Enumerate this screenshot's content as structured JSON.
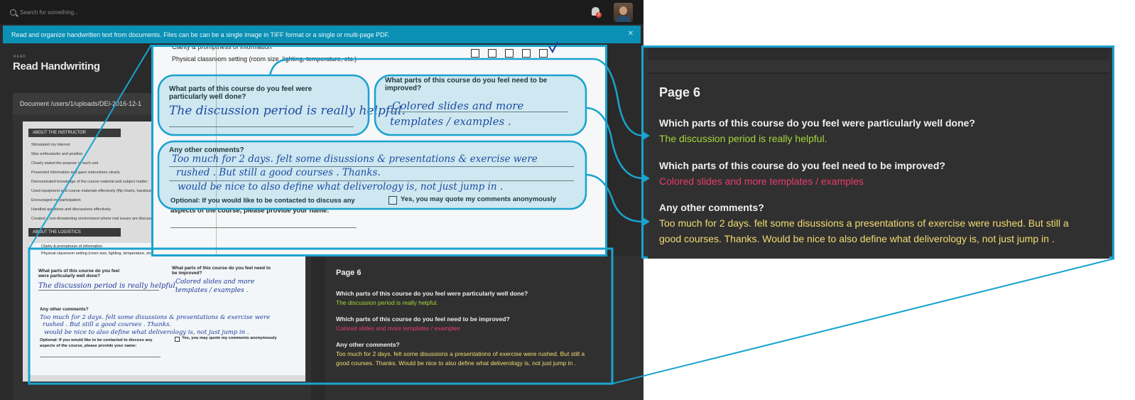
{
  "search": {
    "placeholder": "Search for something..."
  },
  "notifications": {
    "count": "3"
  },
  "banner": {
    "text": "Read and organize handwritten text from documents. Files can be can be a single image in TIFF format or a single or multi-page PDF."
  },
  "breadcrumb": "READ",
  "page_title": "Read Handwriting",
  "document": {
    "path": "Document /users/1/uploads/DEI-2016-12-1"
  },
  "form": {
    "section_instructor": "ABOUT THE INSTRUCTOR",
    "section_logistics": "ABOUT THE LOGISTICS",
    "instructor_items": [
      "Stimulated my interest",
      "Was enthusiastic and positive",
      "Clearly stated the purpose of each unit",
      "Presented information and gave instructions clearly",
      "Demonstrated knowledge of the course material and subject matter",
      "Used equipment and course materials effectively (flip charts, handouts)",
      "Encouraged my participation",
      "Handled questions and discussions effectively",
      "Created a non-threatening environment where real issues are discussed"
    ],
    "logistics_items": [
      "Clarity & promptness of information",
      "Physical classroom setting (room size, lighting, temperature, etc.)"
    ],
    "q1_label": "What parts of this course do you feel were particularly well done?",
    "q2_label": "What parts of this course do you feel need to be improved?",
    "q3_label": "Any other comments?",
    "hw1": "The discussion period is really helpful.",
    "hw2a": "Colored slides and more",
    "hw2b": "templates / examples .",
    "hw3a": "Too much for 2 days. felt some disussions & presentations & exercise were",
    "hw3b": "rushed . But still a good courses . Thanks.",
    "hw3c": "would be nice to also define what deliverology is, not just jump in .",
    "optional_label": "Optional: If you would like to be contacted to discuss any aspects of the course, please provide your name:",
    "optional_line1": "Optional: If you would like to be contacted to discuss any",
    "optional_line2": "aspects of the course, please provide your name:",
    "quote_label": "Yes, you may quote my comments anonymously"
  },
  "results": {
    "page": "Page 6",
    "q1": "Which parts of this course do you feel were particularly well done?",
    "a1": "The discussion period is really helpful.",
    "q2": "Which parts of this course do you feel need to be improved?",
    "a2": "Colored slides and more templates / examples",
    "q3": "Any other comments?",
    "a3_line1": "Too much for 2 days. felt some disussions a presentations of exercise were rushed. But still a",
    "a3_line2": "good courses. Thanks. Would be nice to also define what deliverology is, not just jump in ."
  },
  "colors": {
    "accent": "#1aa3cf",
    "answer_green": "#a4d63a",
    "answer_pink": "#e63d6e",
    "answer_yellow": "#f3dc73"
  }
}
